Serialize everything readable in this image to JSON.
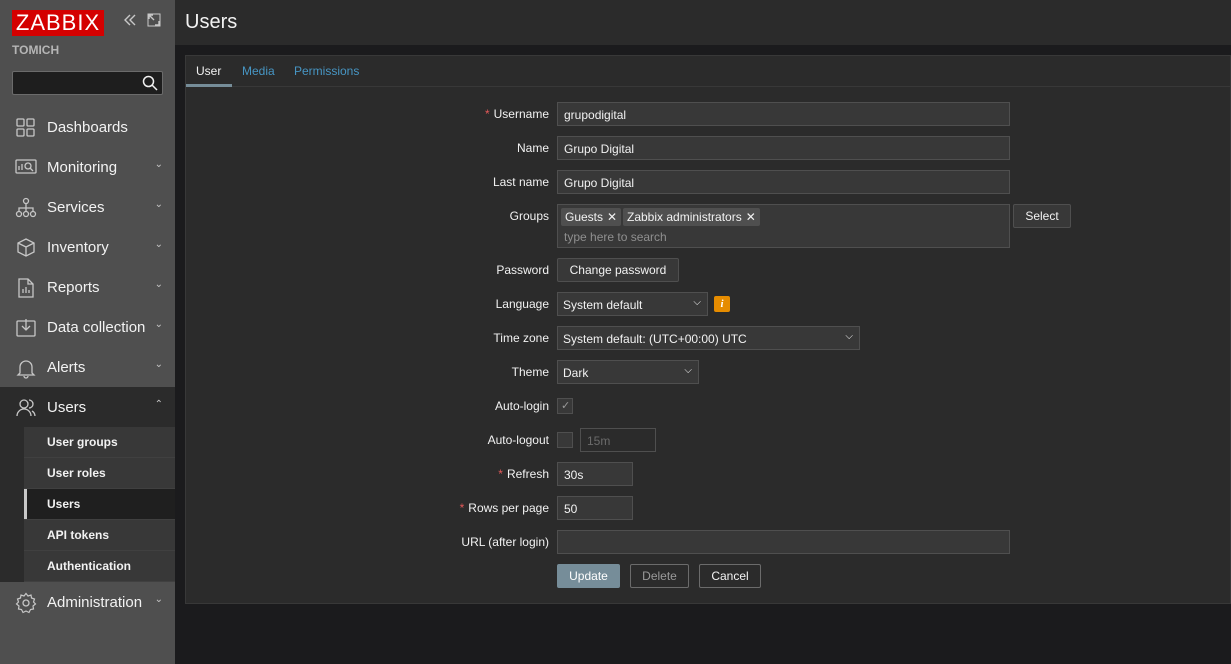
{
  "sidebar": {
    "logo": "ZABBIX",
    "node_name": "TOMICH",
    "search_placeholder": "",
    "items": [
      {
        "label": "Dashboards",
        "icon": "dashboards-icon"
      },
      {
        "label": "Monitoring",
        "icon": "monitoring-icon"
      },
      {
        "label": "Services",
        "icon": "services-icon"
      },
      {
        "label": "Inventory",
        "icon": "inventory-icon"
      },
      {
        "label": "Reports",
        "icon": "reports-icon"
      },
      {
        "label": "Data collection",
        "icon": "data-collection-icon"
      },
      {
        "label": "Alerts",
        "icon": "alerts-icon"
      },
      {
        "label": "Users",
        "icon": "users-icon"
      },
      {
        "label": "Administration",
        "icon": "administration-icon"
      }
    ],
    "users_submenu": [
      "User groups",
      "User roles",
      "Users",
      "API tokens",
      "Authentication"
    ]
  },
  "page": {
    "title": "Users"
  },
  "tabs": [
    "User",
    "Media",
    "Permissions"
  ],
  "form": {
    "username": {
      "label": "Username",
      "value": "grupodigital"
    },
    "name": {
      "label": "Name",
      "value": "Grupo Digital"
    },
    "last_name": {
      "label": "Last name",
      "value": "Grupo Digital"
    },
    "groups": {
      "label": "Groups",
      "chips": [
        "Guests",
        "Zabbix administrators"
      ],
      "placeholder": "type here to search",
      "select_button": "Select"
    },
    "password": {
      "label": "Password",
      "button": "Change password"
    },
    "language": {
      "label": "Language",
      "value": "System default",
      "info": "i"
    },
    "timezone": {
      "label": "Time zone",
      "value": "System default: (UTC+00:00) UTC"
    },
    "theme": {
      "label": "Theme",
      "value": "Dark"
    },
    "autologin": {
      "label": "Auto-login",
      "checked": true
    },
    "autologout": {
      "label": "Auto-logout",
      "checked": false,
      "value": "15m"
    },
    "refresh": {
      "label": "Refresh",
      "value": "30s"
    },
    "rows_per_page": {
      "label": "Rows per page",
      "value": "50"
    },
    "url": {
      "label": "URL (after login)",
      "value": ""
    },
    "buttons": {
      "update": "Update",
      "delete": "Delete",
      "cancel": "Cancel"
    }
  },
  "colors": {
    "brand": "#d40000",
    "link": "#4796c4",
    "required": "#e45959",
    "primary_button": "#768d99",
    "info_badge": "#e68c00"
  }
}
